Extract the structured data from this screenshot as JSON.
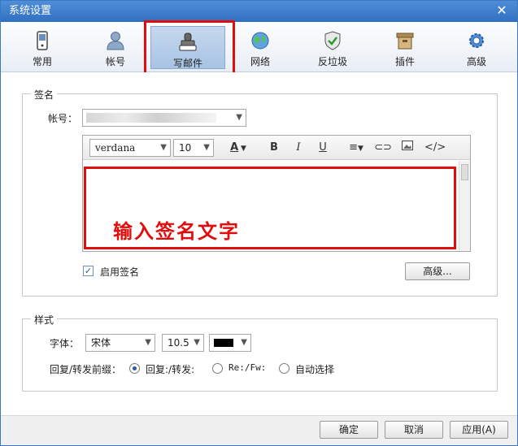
{
  "window": {
    "title": "系统设置"
  },
  "toolbar": {
    "items": [
      {
        "label": "常用",
        "icon": "phone-icon"
      },
      {
        "label": "帐号",
        "icon": "user-icon"
      },
      {
        "label": "写邮件",
        "icon": "stamp-icon"
      },
      {
        "label": "网络",
        "icon": "globe-icon"
      },
      {
        "label": "反垃圾",
        "icon": "shield-icon"
      },
      {
        "label": "插件",
        "icon": "box-icon"
      },
      {
        "label": "高级",
        "icon": "gear-icon"
      }
    ],
    "active": "写邮件"
  },
  "signature": {
    "group_title": "签名",
    "account_label": "帐号：",
    "editor": {
      "font_family": "verdana",
      "font_size": "10",
      "buttons": [
        "A",
        "B",
        "I",
        "U"
      ],
      "annotation": "输入签名文字"
    },
    "enable_label": "启用签名",
    "enabled": true,
    "advanced_button": "高级..."
  },
  "style": {
    "group_title": "样式",
    "font_label": "字体：",
    "font_value": "宋体",
    "size_value": "10.5",
    "color_value": "#000000",
    "prefix_label": "回复/转发前缀：",
    "prefix_options": [
      "回复:/转发:",
      "Re:/Fw:",
      "自动选择"
    ],
    "prefix_selected": "回复:/转发:"
  },
  "footer": {
    "ok": "确定",
    "cancel": "取消",
    "apply": "应用(A)"
  }
}
